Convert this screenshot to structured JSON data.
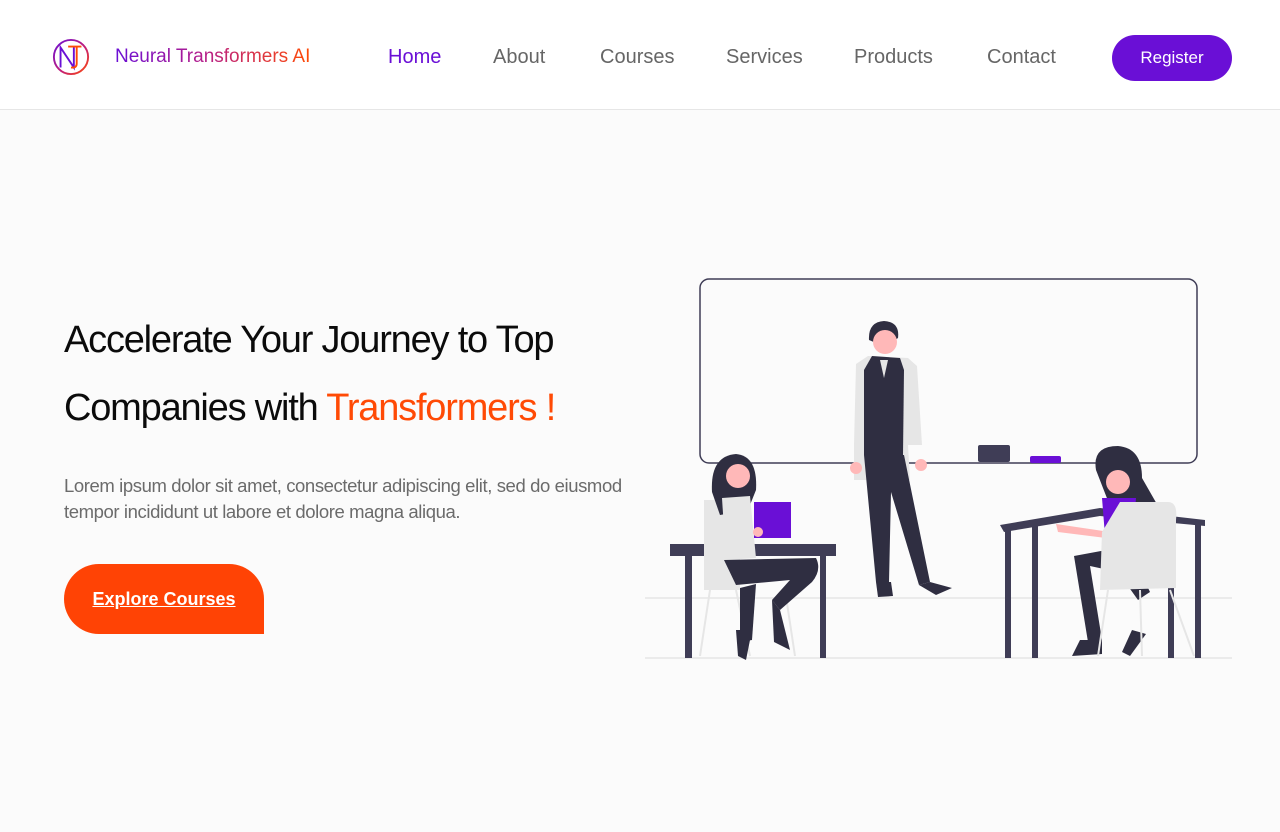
{
  "header": {
    "brand": "Neural Transformers AI",
    "logo_icon": "nt-monogram-icon",
    "nav": [
      {
        "label": "Home",
        "active": true
      },
      {
        "label": "About",
        "active": false
      },
      {
        "label": "Courses",
        "active": false
      },
      {
        "label": "Services",
        "active": false
      },
      {
        "label": "Products",
        "active": false
      },
      {
        "label": "Contact",
        "active": false
      }
    ],
    "register_label": "Register"
  },
  "hero": {
    "title_line1": "Accelerate Your Journey to Top",
    "title_line2_prefix": "Companies with ",
    "title_accent": "Transformers !",
    "description": "Lorem ipsum dolor sit amet, consectetur adipiscing elit, sed do eiusmod tempor incididunt ut labore et dolore magna aliqua.",
    "cta_label": "Explore Courses"
  },
  "colors": {
    "primary": "#6a0fd6",
    "accent": "#ff4a05",
    "nav_text": "#666666",
    "background": "#fbfbfb"
  }
}
